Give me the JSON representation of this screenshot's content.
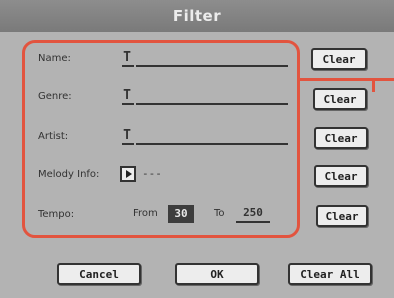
{
  "window": {
    "title": "Filter"
  },
  "fields": {
    "name": {
      "label": "Name:"
    },
    "genre": {
      "label": "Genre:"
    },
    "artist": {
      "label": "Artist:"
    },
    "melody": {
      "label": "Melody Info:",
      "value": "---"
    },
    "tempo": {
      "label": "Tempo:",
      "from_label": "From",
      "from_value": "30",
      "to_label": "To",
      "to_value": "250"
    }
  },
  "clear_label": "Clear",
  "buttons": {
    "cancel": "Cancel",
    "ok": "OK",
    "clear_all": "Clear All"
  },
  "text_cursor_glyph": "T",
  "colors": {
    "highlight": "#e2543f",
    "background": "#b3b3b3",
    "titlebar": "#7a7a7a"
  }
}
